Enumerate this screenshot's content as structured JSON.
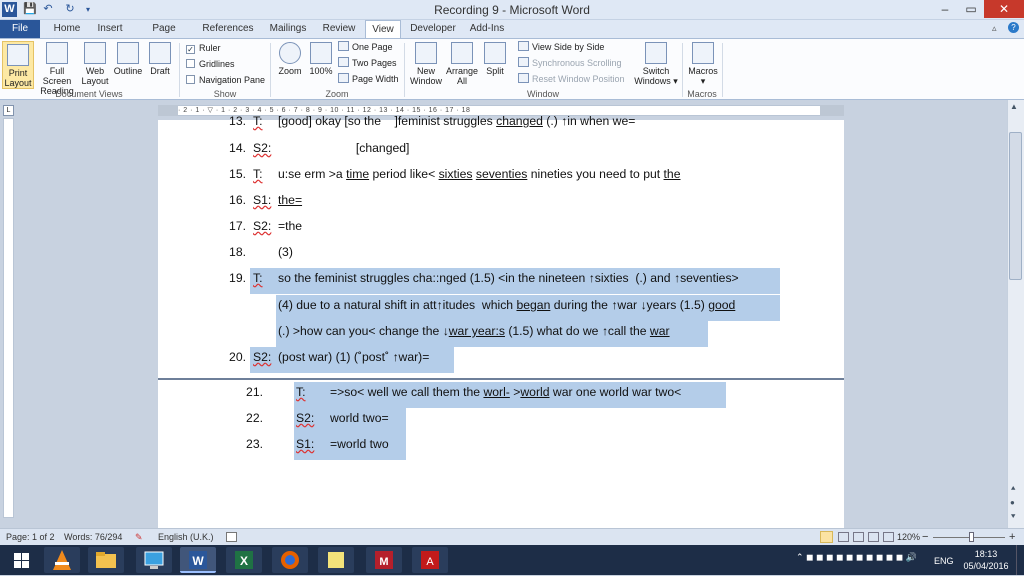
{
  "window": {
    "title": "Recording 9 - Microsoft Word",
    "minimize": "–",
    "maximize": "▭",
    "close": "✕"
  },
  "ribbon_tabs": [
    "File",
    "Home",
    "Insert",
    "Page Layout",
    "References",
    "Mailings",
    "Review",
    "View",
    "Developer",
    "Add-Ins"
  ],
  "ribbon": {
    "document_views": {
      "group": "Document Views",
      "print_layout_1": "Print",
      "print_layout_2": "Layout",
      "full_screen_1": "Full Screen",
      "full_screen_2": "Reading",
      "web_layout_1": "Web",
      "web_layout_2": "Layout",
      "outline": "Outline",
      "draft": "Draft"
    },
    "show": {
      "group": "Show",
      "ruler": "Ruler",
      "gridlines": "Gridlines",
      "navigation_pane": "Navigation Pane"
    },
    "zoom": {
      "group": "Zoom",
      "zoom": "Zoom",
      "hundred": "100%",
      "one_page": "One Page",
      "two_pages": "Two Pages",
      "page_width": "Page Width"
    },
    "window": {
      "group": "Window",
      "new_window_1": "New",
      "new_window_2": "Window",
      "arrange_all_1": "Arrange",
      "arrange_all_2": "All",
      "split": "Split",
      "view_side": "View Side by Side",
      "sync_scroll": "Synchronous Scrolling",
      "reset_position": "Reset Window Position",
      "switch_windows_1": "Switch",
      "switch_windows_2": "Windows ▾"
    },
    "macros": {
      "group": "Macros",
      "macros": "Macros",
      "macros_arrow": "▾"
    }
  },
  "ruler_numbers": "· 2 · 1 · ▽ · 1 · 2 · 3 · 4 · 5 · 6 · 7 · 8 · 9 · 10 · 11 · 12 · 13 · 14 · 15 · 16 · 17 · 18",
  "transcript_page1": [
    {
      "n": "13.",
      "spk": "T:",
      "segs": [
        {
          "t": "[good] okay [so the    ]feminist struggles ",
          "u": false
        },
        {
          "t": "changed",
          "u": true
        },
        {
          "t": " (.) ↑in when we=",
          "u": false
        }
      ]
    },
    {
      "n": "14.",
      "spk": "S2:",
      "segs": [
        {
          "t": "                       [changed]",
          "u": false
        }
      ]
    },
    {
      "n": "15.",
      "spk": "T:",
      "segs": [
        {
          "t": "u:se erm >a ",
          "u": false
        },
        {
          "t": "time",
          "u": true
        },
        {
          "t": " period like< ",
          "u": false
        },
        {
          "t": "sixties",
          "u": true
        },
        {
          "t": " ",
          "u": false
        },
        {
          "t": "seventies",
          "u": true
        },
        {
          "t": " nineties you need to put ",
          "u": false
        },
        {
          "t": "the",
          "u": true
        }
      ]
    },
    {
      "n": "16.",
      "spk": "S1:",
      "segs": [
        {
          "t": "the=",
          "u": true
        }
      ]
    },
    {
      "n": "17.",
      "spk": "S2:",
      "segs": [
        {
          "t": "=the",
          "u": false
        }
      ]
    },
    {
      "n": "18.",
      "spk": "",
      "segs": [
        {
          "t": "(3)",
          "u": false
        }
      ]
    },
    {
      "n": "19.",
      "spk": "T:",
      "segs": [
        {
          "t": "so the feminist struggles cha::nged (1.5) <in the nineteen ↑sixties  (.) and ↑seventies>",
          "u": false
        }
      ]
    },
    {
      "n": "",
      "spk": "",
      "segs": [
        {
          "t": "(4) due to a natural shift in att↑itudes  which ",
          "u": false
        },
        {
          "t": "began",
          "u": true
        },
        {
          "t": " during the ↑war ↓years (1.5) ",
          "u": false
        },
        {
          "t": "good",
          "u": true
        }
      ]
    },
    {
      "n": "",
      "spk": "",
      "segs": [
        {
          "t": "(.) >how can you< change the ↓",
          "u": false
        },
        {
          "t": "war year:s",
          "u": true
        },
        {
          "t": " (1.5) what do we ↑call the ",
          "u": false
        },
        {
          "t": "war",
          "u": true
        }
      ]
    },
    {
      "n": "20.",
      "spk": "S2:",
      "segs": [
        {
          "t": "(post war) (1) (˚post˚ ↑war)=",
          "u": false
        }
      ]
    }
  ],
  "transcript_page2": [
    {
      "n": "21.",
      "spk": "T:",
      "segs": [
        {
          "t": "=>so< well we call them the ",
          "u": false
        },
        {
          "t": "worl-",
          "u": true
        },
        {
          "t": " >",
          "u": false
        },
        {
          "t": "world",
          "u": true
        },
        {
          "t": " war one world war two<",
          "u": false
        }
      ]
    },
    {
      "n": "22.",
      "spk": "S2:",
      "segs": [
        {
          "t": "world two=",
          "u": false
        }
      ]
    },
    {
      "n": "23.",
      "spk": "S1:",
      "segs": [
        {
          "t": "=world two",
          "u": false
        }
      ]
    }
  ],
  "status": {
    "page": "Page: 1 of 2",
    "words": "Words: 76/294",
    "language": "English (U.K.)",
    "zoom": "120%",
    "zoom_minus": "−",
    "zoom_plus": "+"
  },
  "taskbar": {
    "time": "18:13",
    "date": "05/04/2016",
    "lang": "ENG"
  }
}
